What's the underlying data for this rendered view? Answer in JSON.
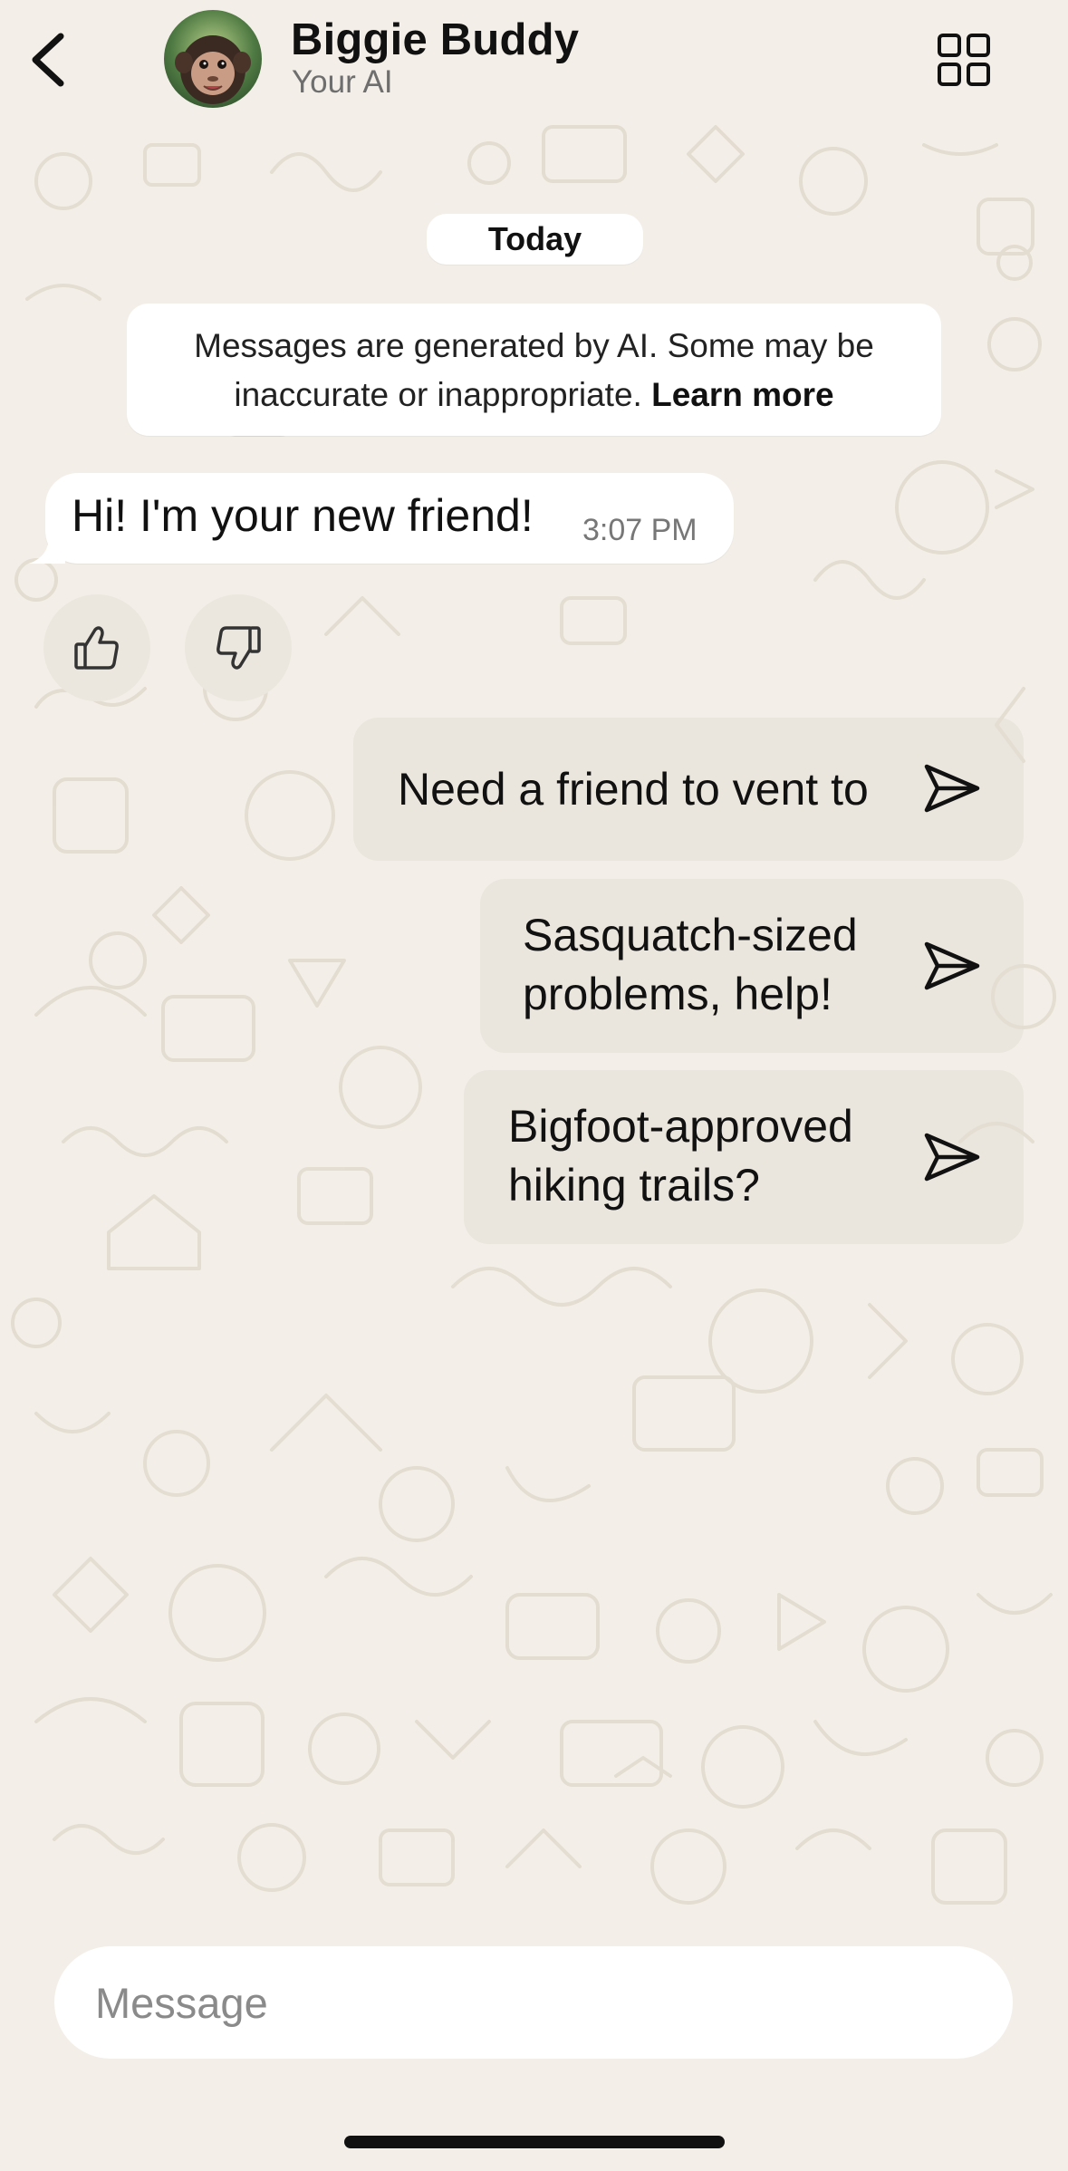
{
  "header": {
    "back_icon": "chevron-left-icon",
    "contact_name": "Biggie Buddy",
    "contact_subtitle": "Your AI",
    "avatar_icon": "monkey-avatar",
    "menu_icon": "grid-icon"
  },
  "chat": {
    "date_label": "Today",
    "ai_notice": {
      "line1": "Messages are generated by AI. Some may be",
      "line2_prefix": "inaccurate or inappropriate. ",
      "learn_more": "Learn more"
    },
    "messages": [
      {
        "direction": "incoming",
        "text": "Hi! I'm your new friend!",
        "time": "3:07 PM"
      }
    ],
    "reactions": {
      "like_icon": "thumbs-up-icon",
      "dislike_icon": "thumbs-down-icon"
    },
    "suggestions": [
      {
        "text": "Need a friend to vent to",
        "icon": "send-icon"
      },
      {
        "text": "Sasquatch-sized problems, help!",
        "icon": "send-icon"
      },
      {
        "text": "Bigfoot-approved hiking trails?",
        "icon": "send-icon"
      }
    ]
  },
  "composer": {
    "placeholder": "Message",
    "value": ""
  },
  "colors": {
    "background": "#f3efe8",
    "bubble": "#ffffff",
    "suggestion_chip": "#e1ddd4",
    "text": "#111111",
    "muted": "#6e6e6e"
  }
}
